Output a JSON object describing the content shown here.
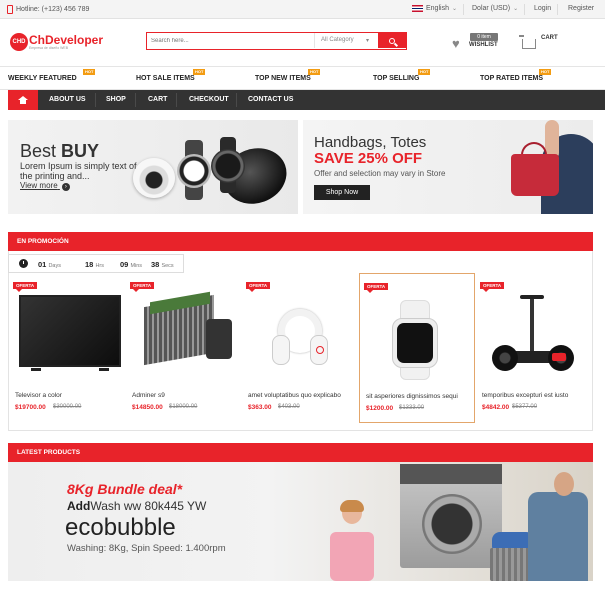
{
  "topbar": {
    "hotline": "Hotline: (+123) 456 789",
    "language": "English",
    "currency": "Dolar (USD)",
    "login": "Login",
    "register": "Register"
  },
  "header": {
    "logo_badge": "CHD",
    "logo_name": "ChDeveloper",
    "logo_tagline": "Empresa de diseño WEB",
    "search_placeholder": "Search here...",
    "category_select": "All Category",
    "wishlist_count": "0 item",
    "wishlist_label": "WISHLIST",
    "cart_label": "CART"
  },
  "categories": [
    {
      "label": "WEEKLY FEATURED",
      "badge": "HOT"
    },
    {
      "label": "HOT SALE ITEMS",
      "badge": "HOT"
    },
    {
      "label": "TOP NEW ITEMS",
      "badge": "HOT"
    },
    {
      "label": "TOP SELLING",
      "badge": "HOT"
    },
    {
      "label": "TOP RATED ITEMS",
      "badge": "HOT"
    }
  ],
  "nav": [
    "ABOUT US",
    "SHOP",
    "CART",
    "CHECKOUT",
    "CONTACT US"
  ],
  "banner_left": {
    "title_light": "Best",
    "title_bold": "BUY",
    "text": "Lorem Ipsum is simply text of the printing and...",
    "link": "View more",
    "link_arrow": "›"
  },
  "banner_right": {
    "title": "Handbags, Totes",
    "headline": "SAVE 25% OFF",
    "text": "Offer and selection may vary in Store",
    "button": "Shop Now"
  },
  "promo": {
    "title": "EN PROMOCIÓN",
    "countdown": {
      "days": "01",
      "days_label": "Days",
      "hrs": "18",
      "hrs_label": "Hrs",
      "mins": "09",
      "mins_label": "Mins",
      "secs": "38",
      "secs_label": "Secs"
    },
    "badge": "OFERTA",
    "products": [
      {
        "name": "Televisor a color",
        "price": "$19700.00",
        "old": "$30000.00"
      },
      {
        "name": "Adminer s9",
        "price": "$14850.00",
        "old": "$18000.00"
      },
      {
        "name": "amet voluptatibus quo explicabo",
        "price": "$363.00",
        "old": "$403.00"
      },
      {
        "name": "sit asperiores dignissimos sequi",
        "price": "$1200.00",
        "old": "$1333.00"
      },
      {
        "name": "temporibus excepturi est iusto",
        "price": "$4842.00",
        "old": "$5377.00"
      }
    ]
  },
  "latest": {
    "title": "LATEST PRODUCTS",
    "deal": "8Kg Bundle deal*",
    "model_bold": "Add",
    "model_rest": "Wash ww 80k445 YW",
    "brand": "ecobubble",
    "spec": "Washing: 8Kg, Spin Speed: 1.400rpm"
  },
  "colors": {
    "accent": "#e8232a",
    "nav_bg": "#333333",
    "hot_badge": "#f39c12"
  }
}
